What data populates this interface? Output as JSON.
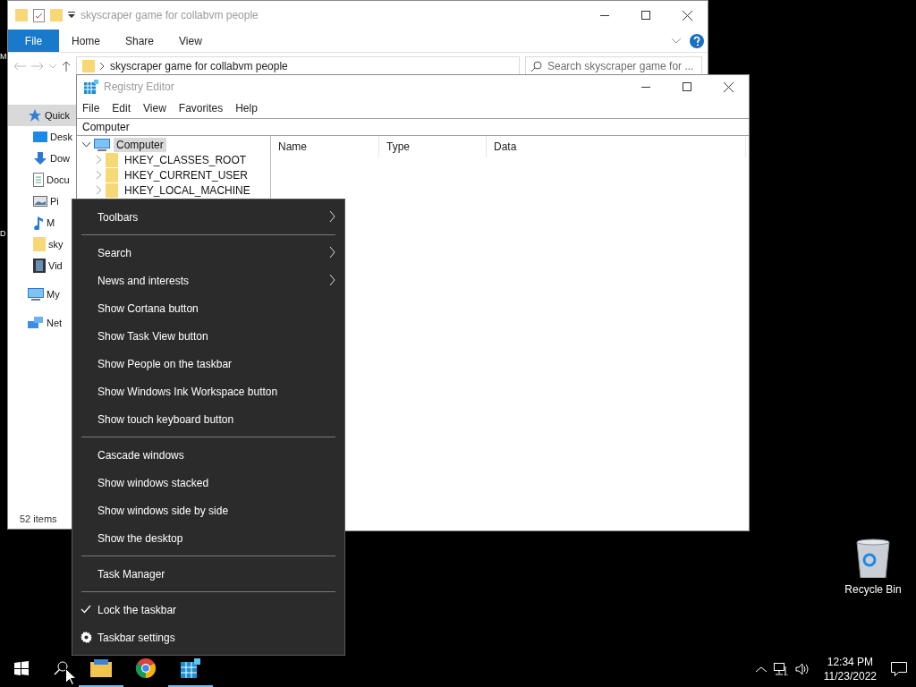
{
  "desktop": {
    "fragments": [
      "M",
      "D"
    ],
    "icons": [
      {
        "label": "Recycle Bin"
      }
    ]
  },
  "explorer": {
    "title": "skyscraper game for collabvm people",
    "ribbon_tabs": [
      {
        "label": "File",
        "selected": true
      },
      {
        "label": "Home",
        "selected": false
      },
      {
        "label": "Share",
        "selected": false
      },
      {
        "label": "View",
        "selected": false
      }
    ],
    "address": "skyscraper game for collabvm people",
    "search": {
      "placeholder": "Search skyscraper game for ..."
    },
    "nav_items": [
      {
        "label": "Quick",
        "kind": "star",
        "selected": true,
        "children": [
          {
            "label": "Desk",
            "kind": "desktop",
            "selected": false
          },
          {
            "label": "Dow",
            "kind": "download",
            "selected": false
          },
          {
            "label": "Docu",
            "kind": "document",
            "selected": false
          },
          {
            "label": "Pi",
            "kind": "picture",
            "selected": false
          },
          {
            "label": "M",
            "kind": "music",
            "selected": false
          },
          {
            "label": "sky",
            "kind": "folder",
            "selected": false
          },
          {
            "label": "Vid",
            "kind": "video",
            "selected": false
          }
        ]
      },
      {
        "label": "My",
        "kind": "pc",
        "selected": false
      },
      {
        "label": "Net",
        "kind": "network",
        "selected": false
      }
    ],
    "status": "52 items"
  },
  "registry": {
    "title": "Registry Editor",
    "menu": [
      "File",
      "Edit",
      "View",
      "Favorites",
      "Help"
    ],
    "address": "Computer",
    "tree": [
      {
        "label": "Computer",
        "kind": "pc",
        "selected": true,
        "expanded": true,
        "children": [
          {
            "label": "HKEY_CLASSES_ROOT",
            "kind": "folder",
            "selected": false,
            "expanded": false
          },
          {
            "label": "HKEY_CURRENT_USER",
            "kind": "folder",
            "selected": false,
            "expanded": false
          },
          {
            "label": "HKEY_LOCAL_MACHINE",
            "kind": "folder",
            "selected": false,
            "expanded": false
          }
        ]
      }
    ],
    "columns": [
      "Name",
      "Type",
      "Data"
    ]
  },
  "context_menu": [
    {
      "kind": "submenu",
      "label": "Toolbars",
      "checked": false
    },
    {
      "kind": "separator"
    },
    {
      "kind": "submenu",
      "label": "Search",
      "checked": false
    },
    {
      "kind": "submenu",
      "label": "News and interests",
      "checked": false
    },
    {
      "kind": "item",
      "label": "Show Cortana button",
      "checked": false
    },
    {
      "kind": "item",
      "label": "Show Task View button",
      "checked": false
    },
    {
      "kind": "item",
      "label": "Show People on the taskbar",
      "checked": false
    },
    {
      "kind": "item",
      "label": "Show Windows Ink Workspace button",
      "checked": false
    },
    {
      "kind": "item",
      "label": "Show touch keyboard button",
      "checked": false
    },
    {
      "kind": "separator"
    },
    {
      "kind": "item",
      "label": "Cascade windows",
      "checked": false
    },
    {
      "kind": "item",
      "label": "Show windows stacked",
      "checked": false
    },
    {
      "kind": "item",
      "label": "Show windows side by side",
      "checked": false
    },
    {
      "kind": "item",
      "label": "Show the desktop",
      "checked": false
    },
    {
      "kind": "separator"
    },
    {
      "kind": "item",
      "label": "Task Manager",
      "checked": false
    },
    {
      "kind": "separator"
    },
    {
      "kind": "item",
      "label": "Lock the taskbar",
      "checked": true
    },
    {
      "kind": "settings",
      "label": "Taskbar settings",
      "checked": false
    }
  ],
  "taskbar": {
    "apps": [
      {
        "kind": "explorer",
        "running": true
      },
      {
        "kind": "chrome",
        "running": false
      },
      {
        "kind": "regedit",
        "running": true
      }
    ],
    "clock": {
      "time": "12:34 PM",
      "date": "11/23/2022"
    }
  }
}
